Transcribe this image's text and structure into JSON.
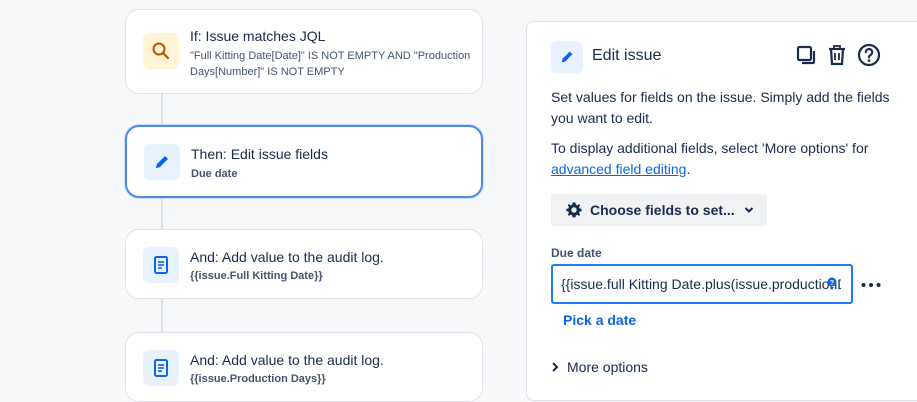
{
  "flow": {
    "cards": [
      {
        "title": "If: Issue matches JQL",
        "subtitle": "\"Full Kitting Date[Date]\" IS NOT EMPTY AND \"Production Days[Number]\" IS NOT EMPTY",
        "icon": "search-icon",
        "icon_bg": "#fff4d6"
      },
      {
        "title": "Then: Edit issue fields",
        "subtitle": "Due date",
        "icon": "pencil-icon",
        "icon_bg": "#e9f2ff",
        "selected": true
      },
      {
        "title": "And: Add value to the audit log.",
        "subtitle": "{{issue.Full Kitting Date}}",
        "icon": "document-icon",
        "icon_bg": "#e9f2ff"
      },
      {
        "title": "And: Add value to the audit log.",
        "subtitle": "{{issue.Production Days}}",
        "icon": "document-icon",
        "icon_bg": "#e9f2ff"
      }
    ]
  },
  "panel": {
    "title": "Edit issue",
    "description": "Set values for fields on the issue. Simply add the fields you want to edit.",
    "more_info_prefix": "To display additional fields, select 'More options' for",
    "more_info_link": "advanced field editing",
    "more_info_suffix": ".",
    "choose_fields_label": "Choose fields to set...",
    "field_label": "Due date",
    "field_value": "{{issue.full Kitting Date.plus(issue.productionD",
    "pick_date_label": "Pick a date",
    "more_options_label": "More options"
  },
  "colors": {
    "accent": "#0c66e4",
    "selected_border": "#4c8ae5",
    "search_icon": "#c25100"
  }
}
